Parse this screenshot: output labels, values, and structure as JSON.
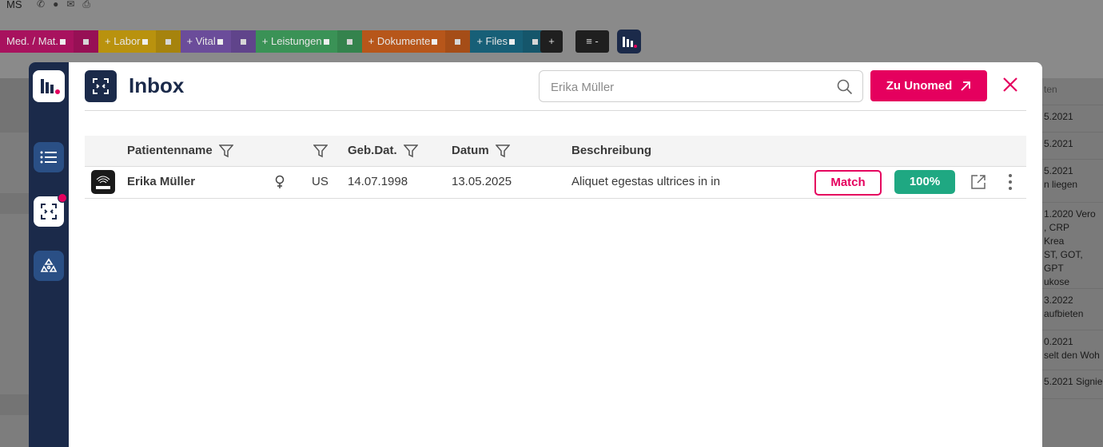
{
  "background": {
    "user_initials": "MS",
    "tabs": [
      {
        "label": "Med. / Mat.",
        "color": "#a8125e"
      },
      {
        "label": "Labor",
        "color": "#b9920e"
      },
      {
        "label": "Vital",
        "color": "#6b4c9a"
      },
      {
        "label": "Leistungen",
        "color": "#3a9256"
      },
      {
        "label": "Dokumente",
        "color": "#b7561a"
      },
      {
        "label": "Files",
        "color": "#175f77"
      }
    ],
    "add_button": "+",
    "menu_button": "≡ -",
    "right_column": {
      "header": "ten",
      "rows": [
        "5.2021",
        "5.2021",
        "5.2021\nn liegen",
        "1.2020 Vero\n, CRP\nKrea\nST, GOT, GPT\nukose",
        "3.2022\naufbieten",
        "0.2021\nselt den Woh",
        "5.2021 Signie"
      ]
    }
  },
  "modal": {
    "title": "Inbox",
    "search": {
      "value": "",
      "placeholder": "Erika Müller"
    },
    "cta_label": "Zu Unomed",
    "columns": {
      "name": "Patientenname",
      "dob": "Geb.Dat.",
      "date": "Datum",
      "description": "Beschreibung"
    },
    "rows": [
      {
        "source_icon": "dicom-icon",
        "name": "Erika Müller",
        "gender_icon": "female-icon",
        "modality": "US",
        "dob": "14.07.1998",
        "date": "13.05.2025",
        "description": "Aliquet egestas ultrices in in",
        "match_label": "Match",
        "score": "100%"
      }
    ]
  },
  "colors": {
    "navy": "#1b2a4a",
    "accent": "#e5005e",
    "success": "#1fa882",
    "sidebar_button": "#2a4f85"
  }
}
